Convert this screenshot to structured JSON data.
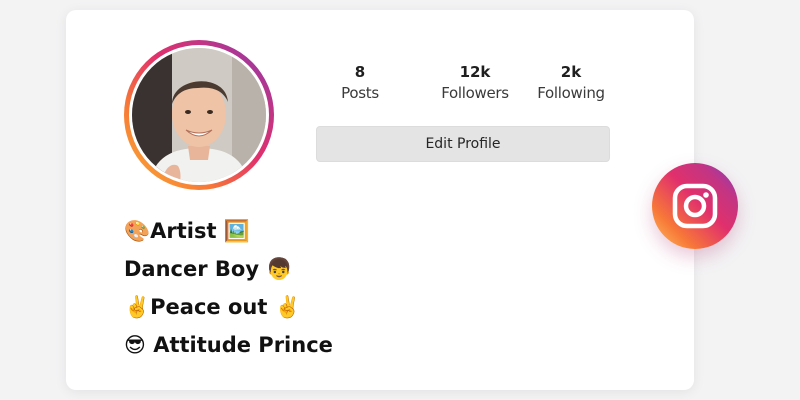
{
  "profile": {
    "stats": [
      {
        "value": "8",
        "label": "Posts"
      },
      {
        "value": "12k",
        "label": "Followers"
      },
      {
        "value": "2k",
        "label": "Following"
      }
    ],
    "edit_label": "Edit Profile",
    "bio": [
      "🎨Artist 🖼️",
      "Dancer Boy 👦",
      "✌️Peace out ✌️",
      "😎 Attitude Prince"
    ]
  },
  "colors": {
    "ring_gradient": [
      "#f9b233",
      "#f77737",
      "#e1306c",
      "#c13584",
      "#833ab4"
    ],
    "button_bg": "#e4e4e4",
    "card_bg": "#ffffff",
    "page_bg": "#f3f3f4"
  },
  "icons": {
    "brand": "instagram-icon"
  }
}
